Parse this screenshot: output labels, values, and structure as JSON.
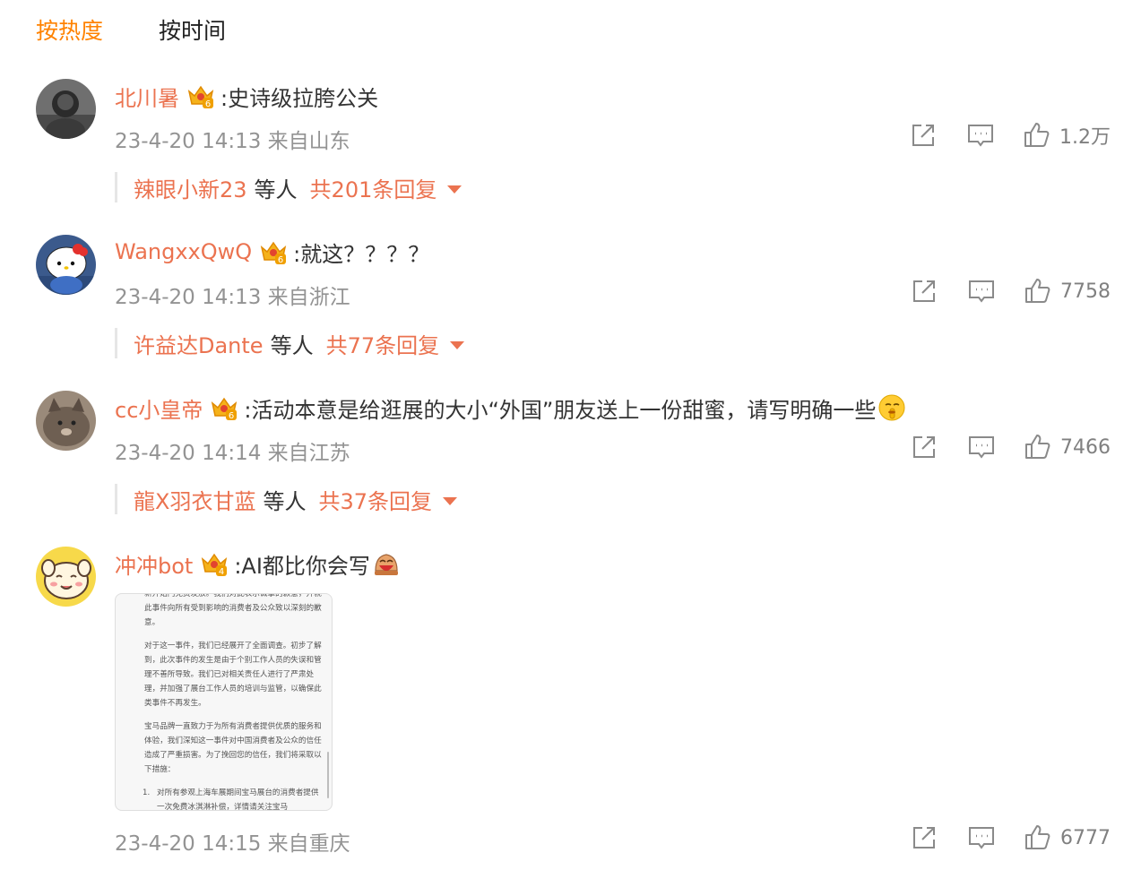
{
  "tabs": [
    {
      "label": "按热度",
      "active": true
    },
    {
      "label": "按时间",
      "active": false
    }
  ],
  "comments": [
    {
      "username": "北川暑",
      "crown_level": "6",
      "text": ":史诗级拉胯公关",
      "meta": "23-4-20 14:13 来自山东",
      "likes": "1.2万",
      "reply": {
        "users": "辣眼小新23",
        "etc": "等人",
        "count": "共201条回复"
      }
    },
    {
      "username": "WangxxQwQ",
      "crown_level": "6",
      "text": ":就这？？？？",
      "meta": "23-4-20 14:13 来自浙江",
      "likes": "7758",
      "reply": {
        "users": "许益达Dante",
        "etc": "等人",
        "count": "共77条回复"
      }
    },
    {
      "username": "cc小皇帝",
      "crown_level": "6",
      "text": ":活动本意是给逛展的大小“外国”朋友送上一份甜蜜，请写明确一些",
      "meta": "23-4-20 14:14 来自江苏",
      "likes": "7466",
      "reply": {
        "users": "龍X羽衣甘蓝",
        "etc": "等人",
        "count": "共37条回复"
      }
    },
    {
      "username": "冲冲bot",
      "crown_level": "4",
      "text": ":AI都比你会写",
      "meta": "23-4-20 14:15 来自重庆",
      "likes": "6777",
      "image": {
        "paragraphs": [
          "新开始门免费发放。我们对此表示诚挚的歉意，并就此事件向所有受到影响的消费者及公众致以深刻的歉意。",
          "对于这一事件，我们已经展开了全面调查。初步了解到，此次事件的发生是由于个别工作人员的失误和管理不善所导致。我们已对相关责任人进行了严肃处理，并加强了展台工作人员的培训与监管，以确保此类事件不再发生。",
          "宝马品牌一直致力于为所有消费者提供优质的服务和体验，我们深知这一事件对中国消费者及公众的信任造成了严重损害。为了挽回您的信任，我们将采取以下措施："
        ],
        "list_number": "1.",
        "list_text": "对所有参观上海车展期间宝马展台的消费者提供一次免费冰淇淋补偿，详情请关注宝马"
      }
    }
  ],
  "colors": {
    "accent": "#ff8200",
    "username": "#eb7350",
    "meta": "#939393",
    "icon": "#8a8a8a"
  },
  "icons": [
    "share-icon",
    "comment-icon",
    "like-icon",
    "crown-badge-icon"
  ]
}
